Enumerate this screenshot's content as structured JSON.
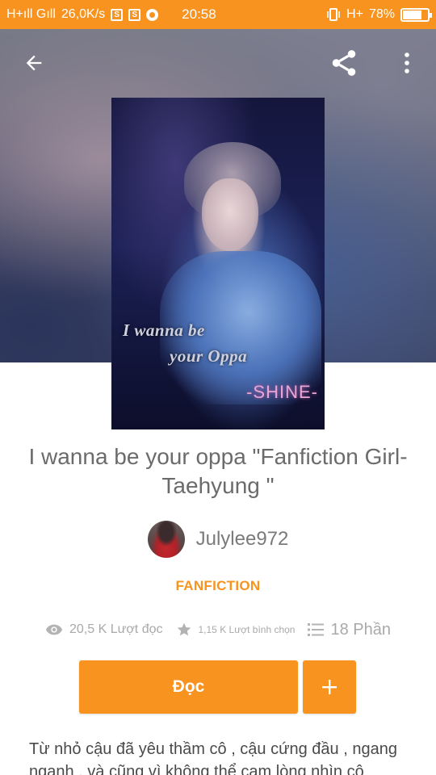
{
  "status_bar": {
    "network_left": "H+ıll Gıll",
    "speed": "26,0K/s",
    "badge_1": "S",
    "badge_2": "S",
    "time": "20:58",
    "network_right": "H+",
    "battery_percent": "78%",
    "battery_level": 0.78
  },
  "toolbar": {
    "back_icon": "arrow-left-icon",
    "share_icon": "share-icon",
    "more_icon": "more-vertical-icon"
  },
  "cover": {
    "title_line1": "I wanna be",
    "title_line2": "your Oppa",
    "signature": "-SHINE-"
  },
  "story": {
    "title": "I wanna be your oppa \"Fanfiction Girl-Taehyung \"",
    "author": "Julylee972",
    "category": "FANFICTION"
  },
  "stats": {
    "reads": "20,5 K Lượt đọc",
    "votes": "1,15 K Lượt bình chọn",
    "parts": "18 Phần"
  },
  "actions": {
    "read_label": "Đọc",
    "add_label": "+"
  },
  "description": "Từ nhỏ cậu đã yêu thầm cô , cậu cứng đầu , ngang ngạnh , và cũng vì không thể cam lòng nhìn cô",
  "colors": {
    "accent": "#f7931e",
    "text_muted": "#a9a9a9",
    "title_text": "#6b6b6b"
  }
}
